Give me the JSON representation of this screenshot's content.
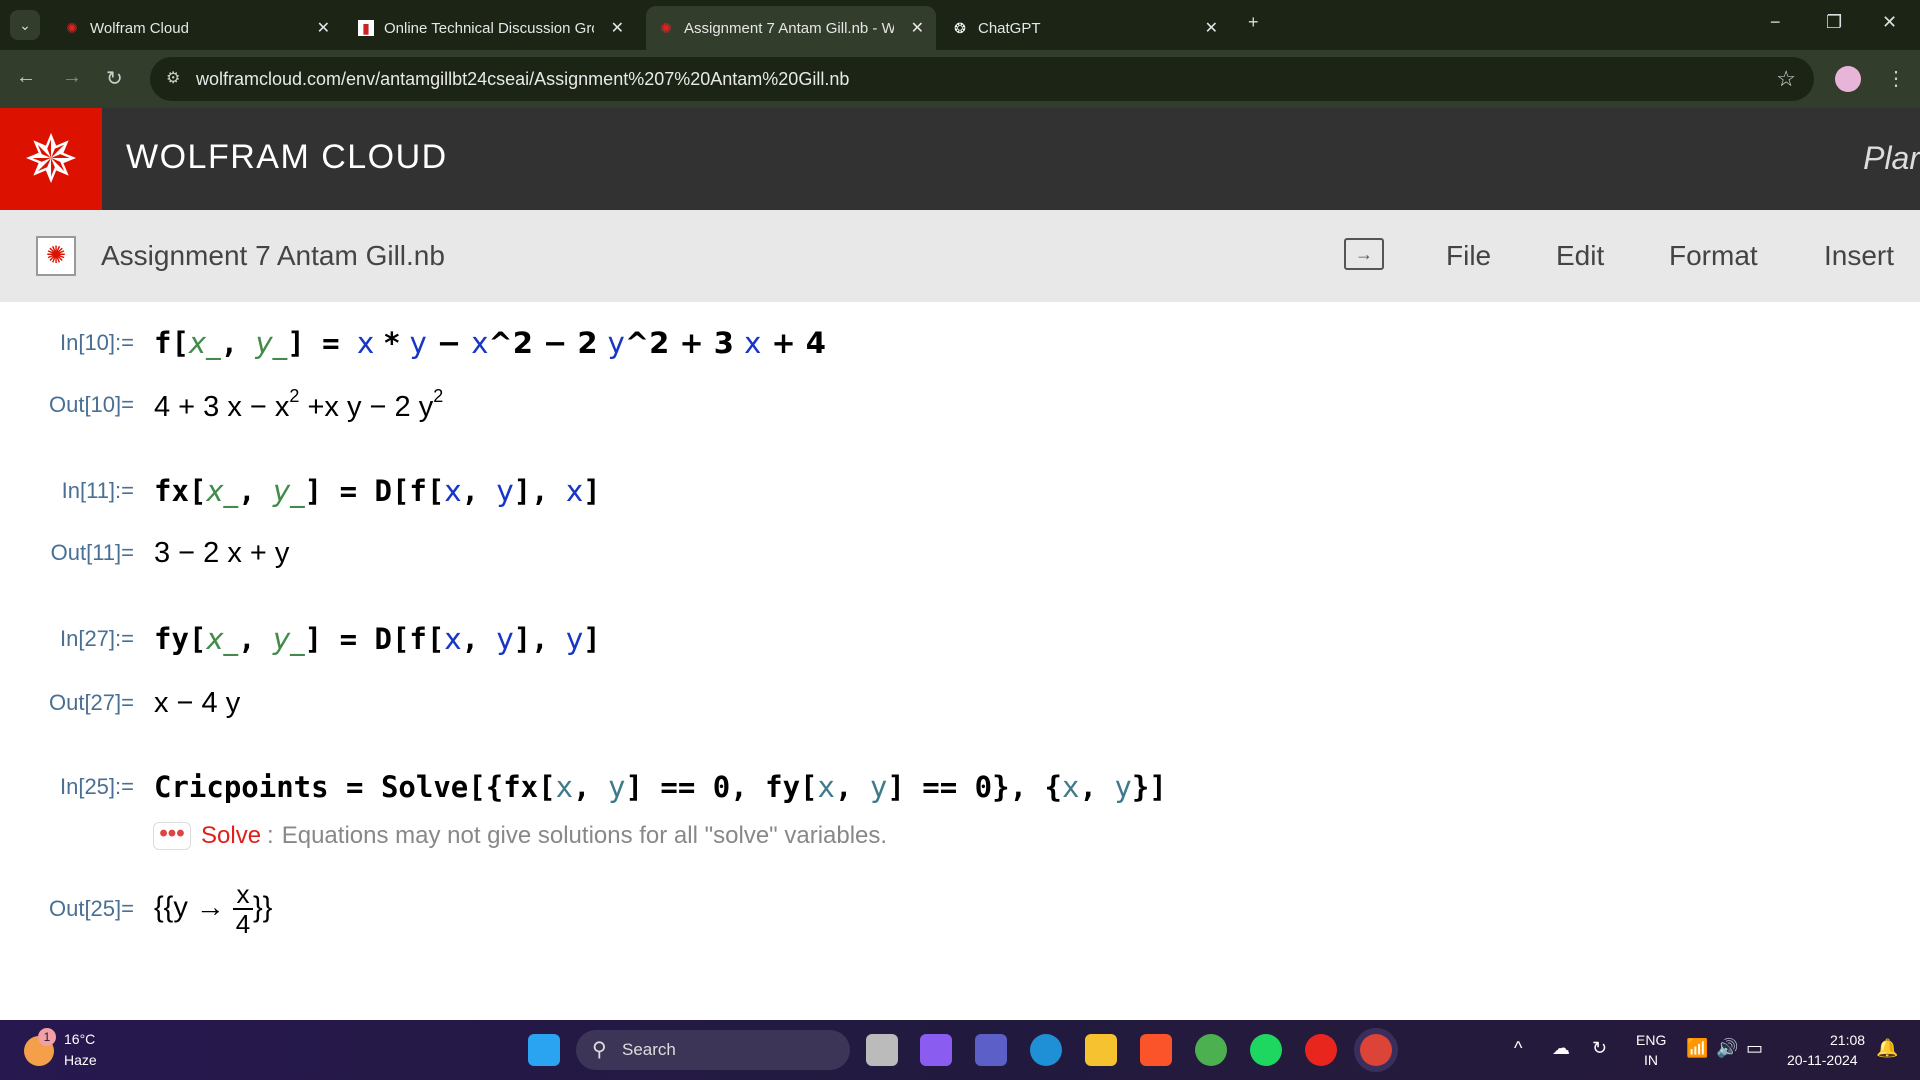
{
  "browser": {
    "tabs": [
      {
        "label": "Wolfram Cloud",
        "icon": "wolfram-icon",
        "active": false
      },
      {
        "label": "Online Technical Discussion Gro",
        "icon": "doc-icon",
        "active": false
      },
      {
        "label": "Assignment 7 Antam Gill.nb - W",
        "icon": "wolfram-icon",
        "active": true
      },
      {
        "label": "ChatGPT",
        "icon": "chatgpt-icon",
        "active": false
      }
    ],
    "url": "wolframcloud.com/env/antamgillbt24cseai/Assignment%207%20Antam%20Gill.nb"
  },
  "header": {
    "brand": "WOLFRAM CLOUD",
    "plan": "Plar",
    "accent": "#dd1100"
  },
  "notebook": {
    "title": "Assignment 7 Antam Gill.nb",
    "menu": [
      "File",
      "Edit",
      "Format",
      "Insert"
    ],
    "cells": [
      {
        "label": "In[10]:=",
        "tokens": [
          [
            "f[",
            ""
          ],
          [
            "x_",
            "pat"
          ],
          [
            ", ",
            ""
          ],
          [
            "y_",
            "pat"
          ],
          [
            "] = ",
            ""
          ],
          [
            "x",
            "var"
          ],
          [
            " * ",
            "op"
          ],
          [
            "y",
            "var"
          ],
          [
            " − ",
            "op"
          ],
          [
            "x",
            "var"
          ],
          [
            "^2 − 2 ",
            "op"
          ],
          [
            "y",
            "var"
          ],
          [
            "^2 + 3 ",
            "op"
          ],
          [
            "x",
            "var"
          ],
          [
            " + 4",
            "op"
          ]
        ]
      },
      {
        "label": "Out[10]=",
        "out": [
          "4 + 3 x − x",
          "2",
          " +x y − 2 y",
          "2"
        ]
      },
      {
        "label": "In[11]:=",
        "tokens": [
          [
            "fx[",
            ""
          ],
          [
            "x_",
            "pat"
          ],
          [
            ", ",
            ""
          ],
          [
            "y_",
            "pat"
          ],
          [
            "] = D[f[",
            ""
          ],
          [
            "x",
            "var"
          ],
          [
            ", ",
            ""
          ],
          [
            "y",
            "var"
          ],
          [
            "], ",
            ""
          ],
          [
            "x",
            "var"
          ],
          [
            "]",
            ""
          ]
        ]
      },
      {
        "label": "Out[11]=",
        "text": "3 − 2 x + y"
      },
      {
        "label": "In[27]:=",
        "tokens": [
          [
            "fy[",
            ""
          ],
          [
            "x_",
            "pat"
          ],
          [
            ", ",
            ""
          ],
          [
            "y_",
            "pat"
          ],
          [
            "] = D[f[",
            ""
          ],
          [
            "x",
            "var"
          ],
          [
            ", ",
            ""
          ],
          [
            "y",
            "var"
          ],
          [
            "], ",
            ""
          ],
          [
            "y",
            "var"
          ],
          [
            "]",
            ""
          ]
        ]
      },
      {
        "label": "Out[27]=",
        "text": "x − 4 y"
      },
      {
        "label": "In[25]:=",
        "tokens": [
          [
            "Cricpoints = Solve[{fx[",
            ""
          ],
          [
            "x",
            "loc"
          ],
          [
            ", ",
            ""
          ],
          [
            "y",
            "loc"
          ],
          [
            "] == 0, fy[",
            ""
          ],
          [
            "x",
            "loc"
          ],
          [
            ", ",
            ""
          ],
          [
            "y",
            "loc"
          ],
          [
            "] == 0}, {",
            ""
          ],
          [
            "x",
            "loc"
          ],
          [
            ", ",
            ""
          ],
          [
            "y",
            "loc"
          ],
          [
            "}]",
            ""
          ]
        ]
      },
      {
        "label": "Out[25]=",
        "solution": {
          "open": "{{y → ",
          "num": "x",
          "den": "4",
          "close": "}}"
        }
      }
    ],
    "message": {
      "dots": "•••",
      "head": "Solve",
      "sep": ":",
      "text": "Equations may not give solutions for all \"solve\" variables."
    }
  },
  "taskbar": {
    "weather": {
      "temp": "16°C",
      "cond": "Haze",
      "badge": "1"
    },
    "search": "Search",
    "lang": "ENG",
    "region": "IN",
    "time": "21:08",
    "date": "20-11-2024"
  }
}
